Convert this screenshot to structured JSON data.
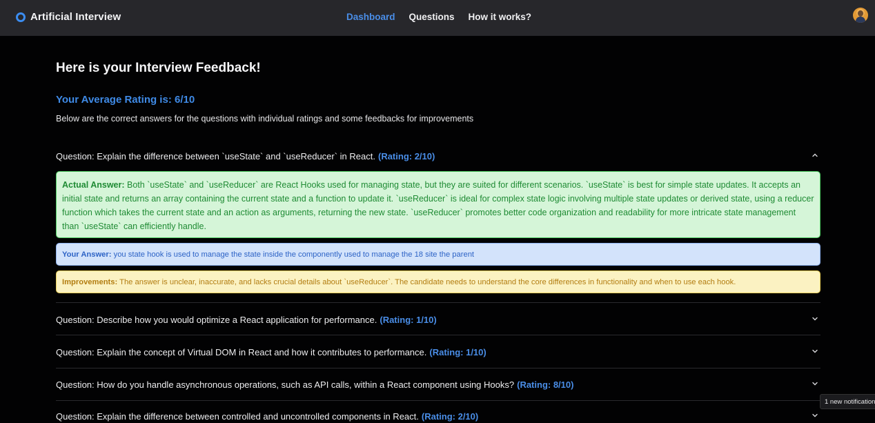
{
  "header": {
    "brand": "Artificial Interview",
    "nav": [
      {
        "label": "Dashboard",
        "active": true
      },
      {
        "label": "Questions",
        "active": false
      },
      {
        "label": "How it works?",
        "active": false
      }
    ]
  },
  "main": {
    "title": "Here is your Interview Feedback!",
    "average_rating": "Your Average Rating is: 6/10",
    "intro": "Below are the correct answers for the questions with individual ratings and some feedbacks for improvements",
    "questions": [
      {
        "text": "Question: Explain the difference between `useState` and `useReducer` in React.",
        "rating": "(Rating: 2/10)",
        "expanded": true,
        "actual_answer_label": "Actual Answer:",
        "actual_answer": "Both `useState` and `useReducer` are React Hooks used for managing state, but they are suited for different scenarios. `useState` is best for simple state updates. It accepts an initial state and returns an array containing the current state and a function to update it. `useReducer` is ideal for complex state logic involving multiple state updates or derived state, using a reducer function which takes the current state and an action as arguments, returning the new state. `useReducer` promotes better code organization and readability for more intricate state management than `useState` can efficiently handle.",
        "your_answer_label": "Your Answer:",
        "your_answer": "you state hook is used to manage the state inside the componently used to manage the 18 site the parent",
        "improvements_label": "Improvements:",
        "improvements": "The answer is unclear, inaccurate, and lacks crucial details about `useReducer`. The candidate needs to understand the core differences in functionality and when to use each hook."
      },
      {
        "text": "Question: Describe how you would optimize a React application for performance.",
        "rating": "(Rating: 1/10)",
        "expanded": false
      },
      {
        "text": "Question: Explain the concept of Virtual DOM in React and how it contributes to performance.",
        "rating": "(Rating: 1/10)",
        "expanded": false
      },
      {
        "text": "Question: How do you handle asynchronous operations, such as API calls, within a React component using Hooks?",
        "rating": "(Rating: 8/10)",
        "expanded": false
      },
      {
        "text": "Question: Explain the difference between controlled and uncontrolled components in React.",
        "rating": "(Rating: 2/10)",
        "expanded": false
      }
    ]
  },
  "toast": "1 new notification",
  "colors": {
    "accent": "#4a8ee8",
    "topbar": "#27272b",
    "background": "#020203",
    "answer_bg": "#d5f5d8",
    "your_answer_bg": "#d3e3fb",
    "improvements_bg": "#fbf2c2"
  },
  "icons": [
    "ring-logo-icon",
    "avatar",
    "chevron-up-icon",
    "chevron-down-icon"
  ]
}
